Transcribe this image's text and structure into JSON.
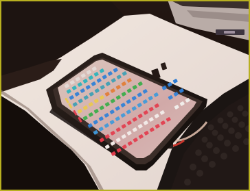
{
  "scene": {
    "subject": "tablet-keypad",
    "palette": {
      "frame": "#b8b020",
      "desk": "#e8ded8",
      "shadow": "#120c08",
      "device_case": "#221815",
      "panel": "#d8b0a8",
      "button_blue": "#2f7dd2",
      "button_green": "#39a846",
      "button_red": "#e03a4a",
      "button_teal": "#2ab0b8",
      "button_orange": "#e07a32",
      "indicator_yellow": "#e8c44a",
      "keyboard": "#1b1513",
      "cable": "#c8352c"
    }
  }
}
